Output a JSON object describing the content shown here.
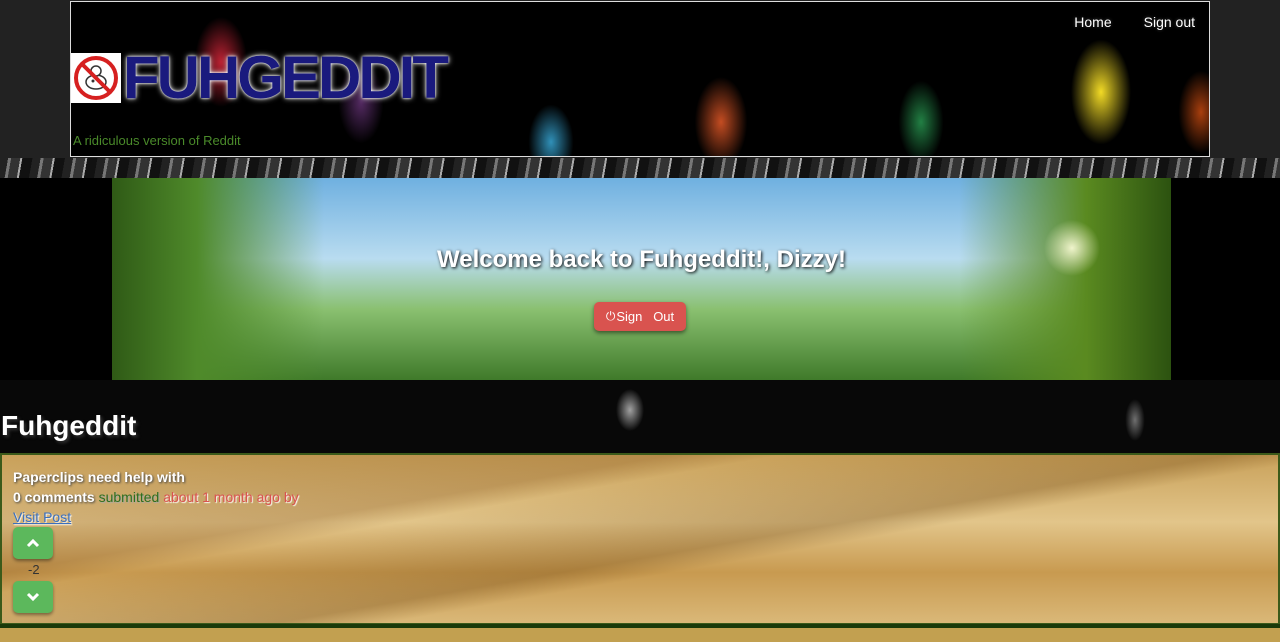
{
  "nav": {
    "home_label": "Home",
    "signout_label": "Sign out"
  },
  "brand": {
    "name": "FUHGEDDIT",
    "tagline": "A ridiculous version of Reddit"
  },
  "hero": {
    "welcome": "Welcome back to Fuhgeddit!, Dizzy!",
    "signout_button": "Sign   Out"
  },
  "section": {
    "title": "Fuhgeddit"
  },
  "posts": [
    {
      "title": "Paperclips need help with",
      "comments": "0 comments",
      "submitted": "submitted",
      "ago": "about 1 month ago by",
      "visit_label": "Visit Post",
      "score": "-2"
    }
  ],
  "colors": {
    "brand_blue": "#1a1a7e",
    "danger": "#d9534f",
    "success": "#5cb85c",
    "link": "#3a6fbd"
  }
}
